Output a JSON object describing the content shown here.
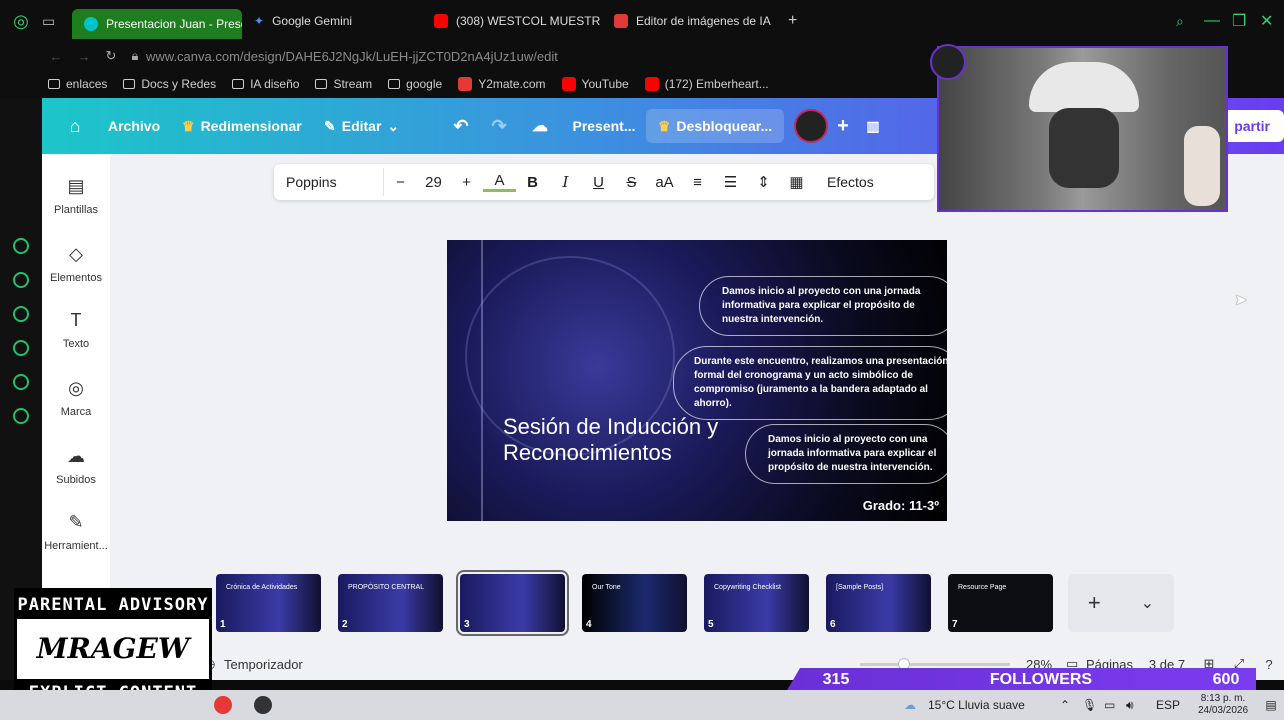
{
  "browser": {
    "tabs": [
      {
        "label": "Presentacion Juan - Prese",
        "active": true,
        "favicon_color": "#00c4cc"
      },
      {
        "label": "Google Gemini",
        "active": false,
        "favicon_color": "#4a8cff"
      },
      {
        "label": "(308) WESTCOL MUESTR",
        "active": false,
        "favicon_color": "#ff0000"
      },
      {
        "label": "Editor de imágenes de IA",
        "active": false,
        "favicon_color": "#e03a3a"
      }
    ],
    "url": "www.canva.com/design/DAHE6J2NgJk/LuEH-jjZCT0D2nA4jUz1uw/edit",
    "bookmarks": [
      "enlaces",
      "Docs y Redes",
      "IA diseño",
      "Stream",
      "google",
      "Y2mate.com",
      "YouTube",
      "(172) Emberheart..."
    ]
  },
  "canva": {
    "topbar": {
      "archivo": "Archivo",
      "redimensionar": "Redimensionar",
      "editar": "Editar",
      "present": "Present...",
      "desbloquear": "Desbloquear...",
      "compartir": "partir"
    },
    "toolbar": {
      "font": "Poppins",
      "minus": "−",
      "size": "29",
      "plus": "+",
      "effects": "Efectos"
    },
    "sidebar": [
      "Plantillas",
      "Elementos",
      "Texto",
      "Marca",
      "Subidos",
      "Herramient..."
    ],
    "slide": {
      "title": "Sesión de Inducción y Reconocimientos",
      "bubble1": "Damos inicio al proyecto con una jornada informativa para explicar el propósito de nuestra intervención.",
      "bubble2": "Durante este encuentro, realizamos una presentación formal del cronograma y un acto simbólico de compromiso (juramento a la bandera adaptado al ahorro).",
      "bubble3": "Damos inicio al proyecto con una jornada informativa para explicar el propósito de nuestra intervención.",
      "grado": "Grado: 11-3º"
    },
    "pages": [
      {
        "num": "1",
        "label": "Crónica de Actividades"
      },
      {
        "num": "2",
        "label": "PROPÓSITO CENTRAL"
      },
      {
        "num": "3",
        "label": ""
      },
      {
        "num": "4",
        "label": "Our Tone"
      },
      {
        "num": "5",
        "label": "Copywriting Checklist"
      },
      {
        "num": "6",
        "label": "[Sample Posts]"
      },
      {
        "num": "7",
        "label": "Resource Page"
      }
    ],
    "bottombar": {
      "timer": "Temporizador",
      "zoom": "28%",
      "pages_label": "Páginas",
      "page_count": "3 de 7"
    }
  },
  "overlay": {
    "parental_top": "PARENTAL ADVISORY",
    "parental_mid": "MRAGEW",
    "parental_bottom": "EXPLICT CONTENT",
    "followers_current": "315",
    "followers_label": "FOLLOWERS",
    "followers_goal": "600"
  },
  "taskbar": {
    "weather": "15°C  Lluvia suave",
    "lang": "ESP",
    "time": "8:13 p. m.",
    "date": "24/03/2026"
  }
}
